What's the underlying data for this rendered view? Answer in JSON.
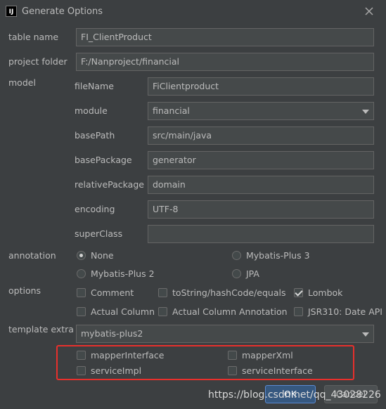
{
  "dialog": {
    "title": "Generate Options",
    "app_icon_text": "IJ"
  },
  "form": {
    "table_name_label": "table name",
    "table_name_value": "FI_ClientProduct",
    "project_folder_label": "project folder",
    "project_folder_value": "F:/Nanproject/financial",
    "model_label": "model",
    "file_name_label": "fileName",
    "file_name_value": "FiClientproduct",
    "module_label": "module",
    "module_value": "financial",
    "base_path_label": "basePath",
    "base_path_value": "src/main/java",
    "base_package_label": "basePackage",
    "base_package_value": "generator",
    "relative_package_label": "relativePackage",
    "relative_package_value": "domain",
    "encoding_label": "encoding",
    "encoding_value": "UTF-8",
    "super_class_label": "superClass",
    "super_class_value": ""
  },
  "annotation": {
    "label": "annotation",
    "options": [
      {
        "label": "None",
        "selected": true
      },
      {
        "label": "Mybatis-Plus 3",
        "selected": false
      },
      {
        "label": "Mybatis-Plus 2",
        "selected": false
      },
      {
        "label": "JPA",
        "selected": false
      }
    ]
  },
  "options": {
    "label": "options",
    "items": [
      {
        "label": "Comment",
        "checked": false
      },
      {
        "label": "toString/hashCode/equals",
        "checked": false
      },
      {
        "label": "Lombok",
        "checked": true
      },
      {
        "label": "Actual Column",
        "checked": false
      },
      {
        "label": "Actual Column Annotation",
        "checked": false
      },
      {
        "label": "JSR310: Date API",
        "checked": false
      }
    ]
  },
  "template_extra": {
    "label": "template extra",
    "value": "mybatis-plus2",
    "items": [
      {
        "label": "mapperInterface",
        "checked": false
      },
      {
        "label": "mapperXml",
        "checked": false
      },
      {
        "label": "serviceImpl",
        "checked": false
      },
      {
        "label": "serviceInterface",
        "checked": false
      }
    ]
  },
  "buttons": {
    "ok_label": "OK",
    "cancel_label": "Cancel"
  },
  "watermark": {
    "text": "https://blog.csdn.net/qq_43028226"
  },
  "colors": {
    "background": "#3c3f41",
    "field": "#45494a",
    "highlight_box": "#e8302c",
    "ok_button": "#365880"
  }
}
